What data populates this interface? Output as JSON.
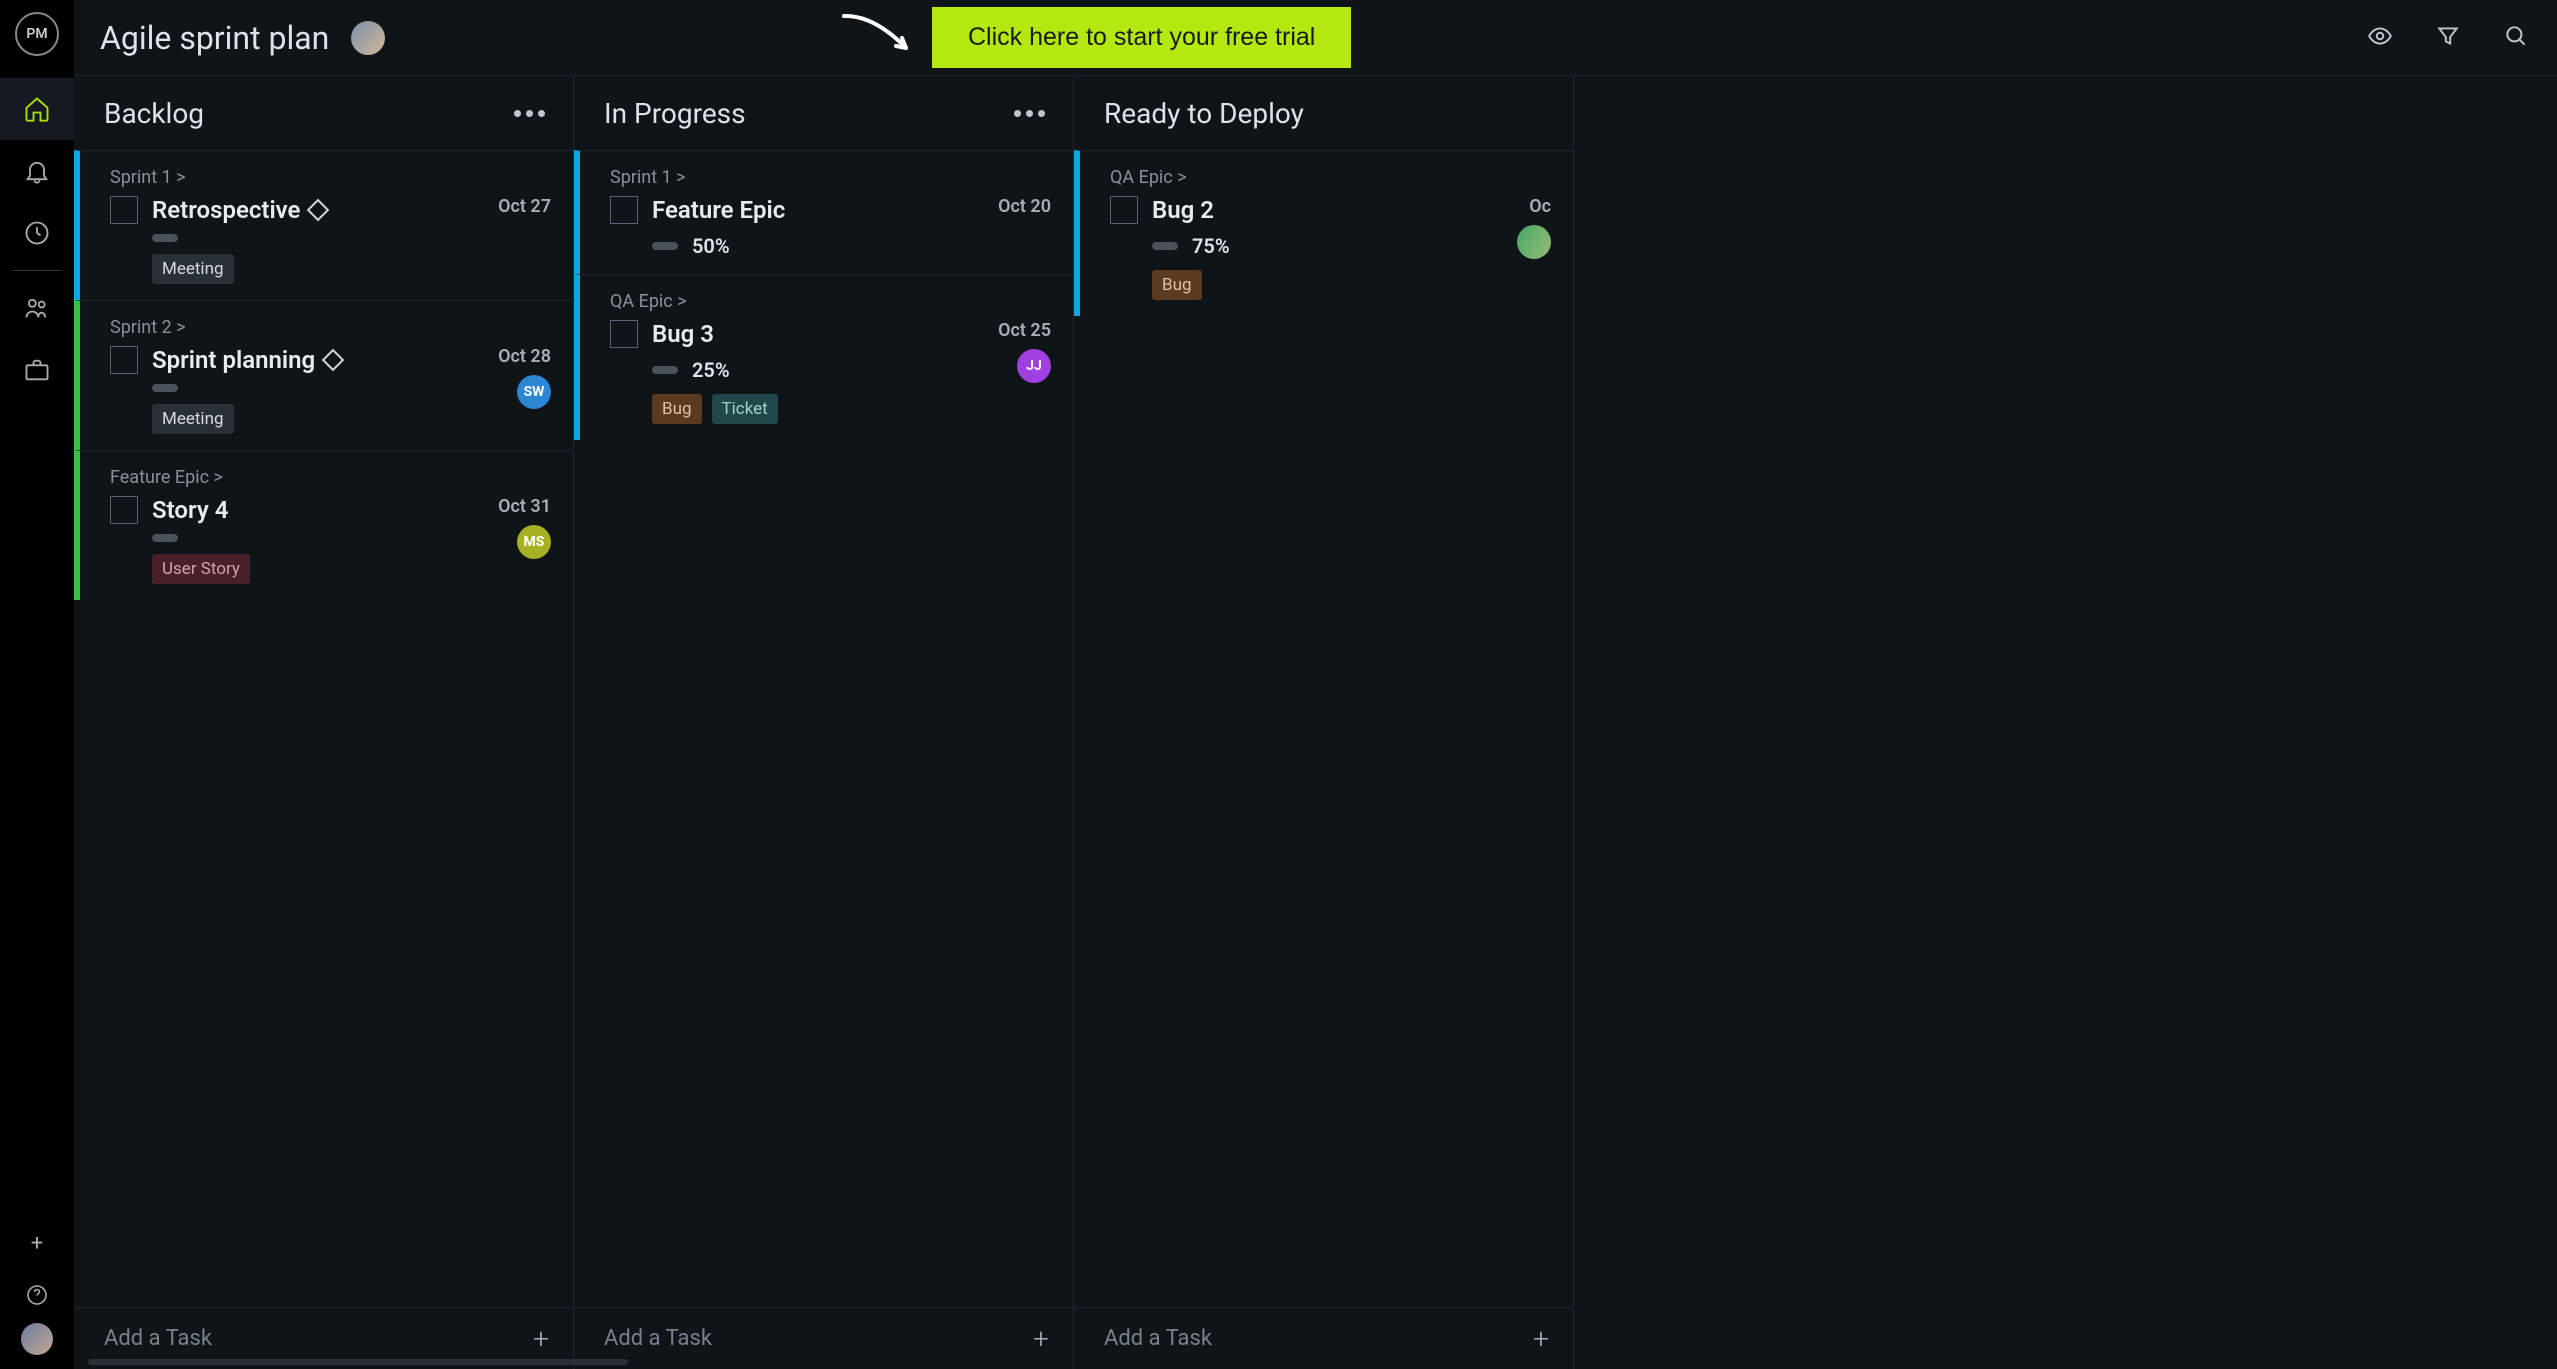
{
  "header": {
    "title": "Agile sprint plan",
    "cta": "Click here to start your free trial",
    "logo": "PM"
  },
  "columns": [
    {
      "title": "Backlog",
      "add_label": "Add a Task",
      "show_menu": true,
      "show_add": true,
      "cards": [
        {
          "hilite": "blue",
          "path": "Sprint 1",
          "title": "Retrospective",
          "milestone": true,
          "pct": "",
          "due": "Oct 27",
          "assignee": null,
          "tags": [
            {
              "text": "Meeting",
              "cls": "tag-meeting"
            }
          ]
        },
        {
          "hilite": "green",
          "path": "Sprint 2",
          "title": "Sprint planning",
          "milestone": true,
          "pct": "",
          "due": "Oct 28",
          "assignee": {
            "initials": "SW",
            "cls": "av-sw"
          },
          "tags": [
            {
              "text": "Meeting",
              "cls": "tag-meeting"
            }
          ]
        },
        {
          "hilite": "green",
          "path": "Feature Epic",
          "title": "Story 4",
          "milestone": false,
          "pct": "",
          "due": "Oct 31",
          "assignee": {
            "initials": "MS",
            "cls": "av-ms"
          },
          "tags": [
            {
              "text": "User Story",
              "cls": "tag-userstory"
            }
          ]
        }
      ]
    },
    {
      "title": "In Progress",
      "add_label": "Add a Task",
      "show_menu": true,
      "show_add": true,
      "cards": [
        {
          "hilite": "blue",
          "path": "Sprint 1",
          "title": "Feature Epic",
          "milestone": false,
          "pct": "50%",
          "due": "Oct 20",
          "assignee": null,
          "tags": []
        },
        {
          "hilite": "blue",
          "path": "QA Epic",
          "title": "Bug 3",
          "milestone": false,
          "pct": "25%",
          "due": "Oct 25",
          "assignee": {
            "initials": "JJ",
            "cls": "av-jj"
          },
          "tags": [
            {
              "text": "Bug",
              "cls": "tag-bug"
            },
            {
              "text": "Ticket",
              "cls": "tag-ticket"
            }
          ]
        }
      ]
    },
    {
      "title": "Ready to Deploy",
      "add_label": "Add a Task",
      "show_menu": false,
      "show_add": true,
      "cards": [
        {
          "hilite": "blue",
          "path": "QA Epic",
          "title": "Bug 2",
          "milestone": false,
          "pct": "75%",
          "due": "Oc",
          "assignee": {
            "initials": "",
            "cls": "av-img"
          },
          "tags": [
            {
              "text": "Bug",
              "cls": "tag-bug"
            }
          ]
        }
      ]
    }
  ]
}
